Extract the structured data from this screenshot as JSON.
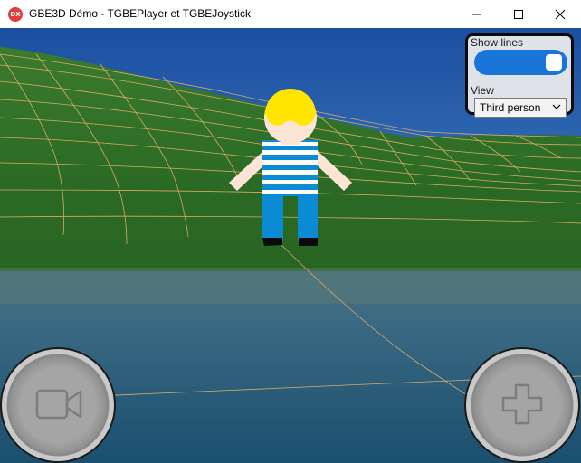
{
  "window": {
    "title": "GBE3D Démo - TGBEPlayer et TGBEJoystick",
    "icon_text": "DX",
    "icon_color": "#e23b3b",
    "controls": [
      "minimize-icon",
      "maximize-icon",
      "close-icon"
    ]
  },
  "scene": {
    "sky_top_color": "#1d5aa8",
    "grass_color": "#336d28",
    "water_color": "#1f5a7a",
    "line_color": "#e8b26a",
    "character": {
      "hair_color": "#ffe500",
      "skin_color": "#fde5d6",
      "shirt_color": "#0b8bd4",
      "pants_color": "#0b8bd4",
      "shoe_color": "#000000"
    }
  },
  "panel": {
    "show_lines_label": "Show lines",
    "show_lines_value": true,
    "toggle_color": "#1976d8",
    "view_label": "View",
    "view_value": "Third person"
  },
  "joysticks": {
    "left_icon": "camera-icon",
    "right_icon": "dpad-icon"
  }
}
